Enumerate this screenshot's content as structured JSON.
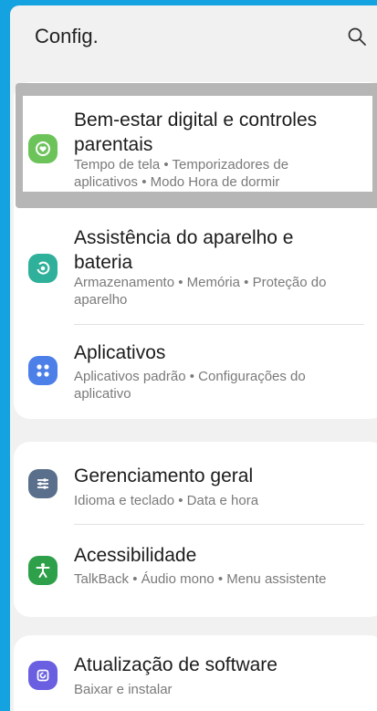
{
  "header": {
    "title": "Config.",
    "search_icon": "search-icon"
  },
  "colors": {
    "frame": "#14a3e0",
    "background": "#f1f1f1",
    "digital_wellbeing": "#6cc35a",
    "device_care": "#2fb09a",
    "apps": "#4d7fe8",
    "general_management": "#5a6f8c",
    "accessibility": "#2ea04a",
    "software_update": "#6a5fe0"
  },
  "groups": [
    {
      "items": [
        {
          "icon": "digital-wellbeing-icon",
          "title": "Bem-estar digital e controles parentais",
          "subtitle": "Tempo de tela  •  Temporizadores de aplicativos  •  Modo Hora de dormir"
        },
        {
          "icon": "device-care-icon",
          "title": "Assistência do aparelho e bateria",
          "subtitle": "Armazenamento  •  Memória  •  Proteção do aparelho"
        },
        {
          "icon": "apps-icon",
          "title": "Aplicativos",
          "subtitle": "Aplicativos padrão  •  Configurações do aplicativo"
        }
      ]
    },
    {
      "items": [
        {
          "icon": "general-management-icon",
          "title": "Gerenciamento geral",
          "subtitle": "Idioma e teclado  •  Data e hora"
        },
        {
          "icon": "accessibility-icon",
          "title": "Acessibilidade",
          "subtitle": "TalkBack  •  Áudio mono  •  Menu assistente"
        }
      ]
    },
    {
      "items": [
        {
          "icon": "software-update-icon",
          "title": "Atualização de software",
          "subtitle": "Baixar e instalar"
        }
      ]
    }
  ]
}
